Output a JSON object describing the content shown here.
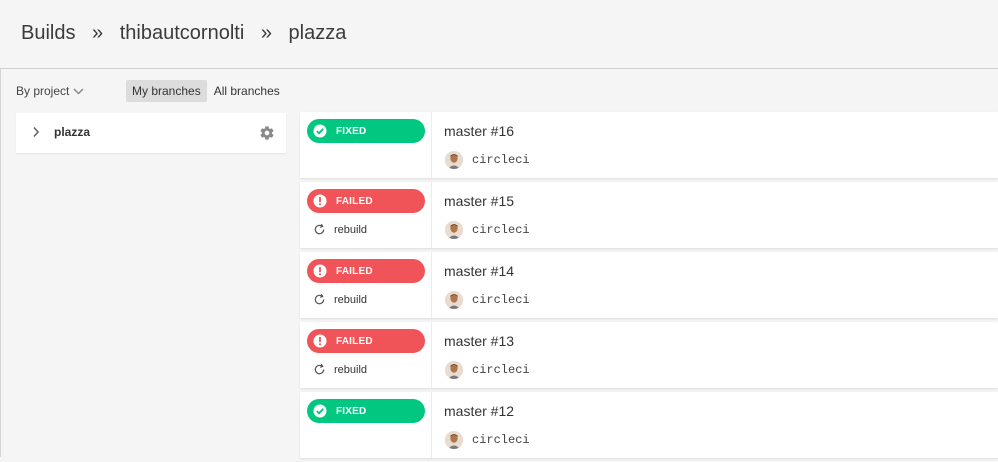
{
  "breadcrumb": {
    "items": [
      "Builds",
      "thibautcornolti",
      "plazza"
    ],
    "separator": "»"
  },
  "filter": {
    "label": "By project"
  },
  "tabs": [
    {
      "label": "My branches",
      "active": true
    },
    {
      "label": "All branches",
      "active": false
    }
  ],
  "project": {
    "name": "plazza"
  },
  "colors": {
    "fixed": "#01c781",
    "failed": "#f05358"
  },
  "builds": [
    {
      "status": "FIXED",
      "title": "master #16",
      "user": "circleci",
      "action": ""
    },
    {
      "status": "FAILED",
      "title": "master #15",
      "user": "circleci",
      "action": "rebuild"
    },
    {
      "status": "FAILED",
      "title": "master #14",
      "user": "circleci",
      "action": "rebuild"
    },
    {
      "status": "FAILED",
      "title": "master #13",
      "user": "circleci",
      "action": "rebuild"
    },
    {
      "status": "FIXED",
      "title": "master #12",
      "user": "circleci",
      "action": ""
    }
  ]
}
